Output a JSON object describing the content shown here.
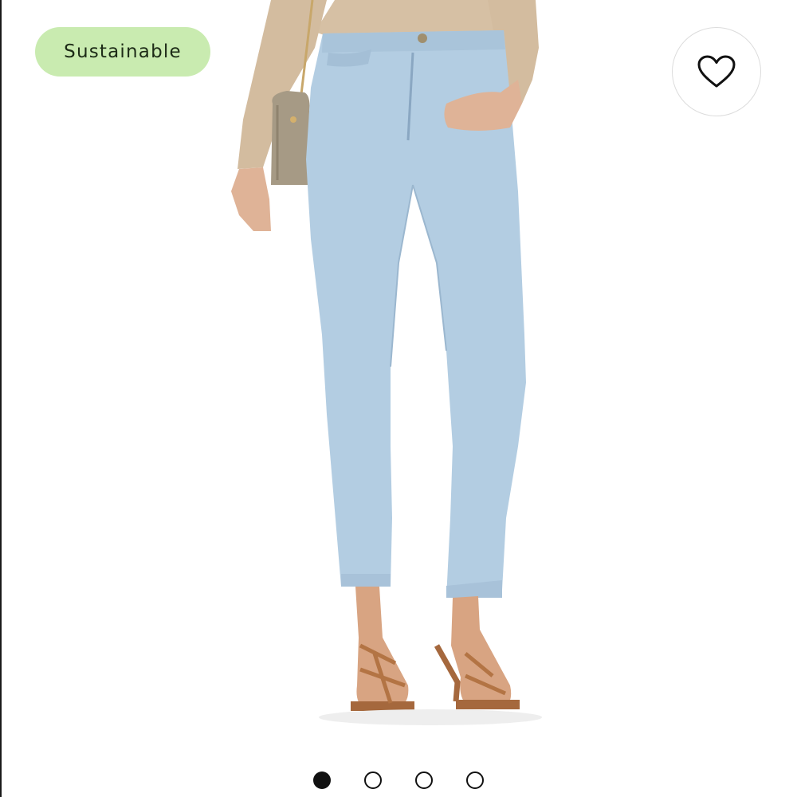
{
  "badge": {
    "label": "Sustainable"
  },
  "favorite": {
    "icon": "heart-icon"
  },
  "carousel": {
    "total": 4,
    "active_index": 0
  },
  "colors": {
    "badge_bg": "#c9ebb0",
    "denim": "#b3cde2",
    "skin": "#d8a482",
    "sweater": "#d6c0a4",
    "bag": "#a69a85"
  }
}
